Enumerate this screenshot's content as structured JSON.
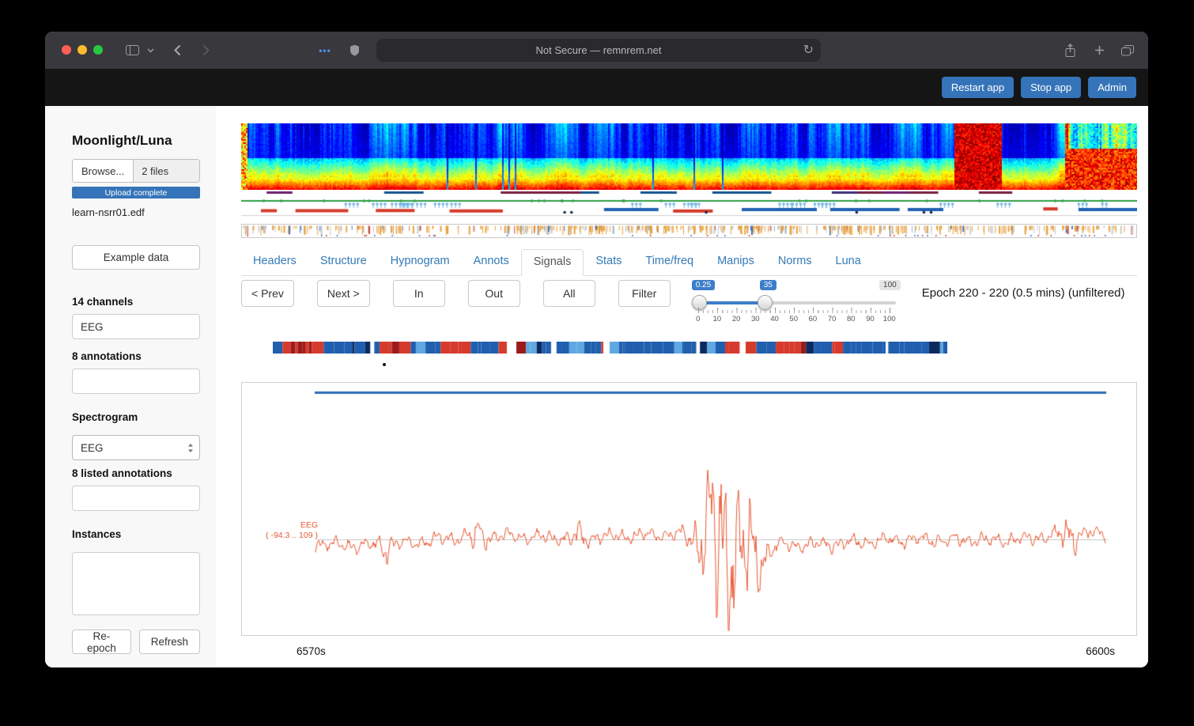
{
  "colors": {
    "accent_blue": "#3574b9",
    "link_blue": "#337ab7",
    "signal_orange": "#e85a35",
    "green_line": "#2f9e44"
  },
  "browser": {
    "address": "Not Secure — remnrem.net"
  },
  "app_header": {
    "restart_label": "Restart app",
    "stop_label": "Stop app",
    "admin_label": "Admin"
  },
  "sidebar": {
    "title": "Moonlight/Luna",
    "browse_label": "Browse...",
    "files_count": "2 files",
    "upload_status": "Upload complete",
    "filename": "learn-nsrr01.edf",
    "example_data_label": "Example data",
    "channels_heading": "14 channels",
    "channel_selected": "EEG",
    "annotations_heading": "8 annotations",
    "spectrogram_heading": "Spectrogram",
    "spectrogram_selected": "EEG",
    "listed_annotations_heading": "8 listed annotations",
    "instances_heading": "Instances",
    "reepoch_label": "Re-epoch",
    "refresh_label": "Refresh"
  },
  "tabs": [
    {
      "label": "Headers"
    },
    {
      "label": "Structure"
    },
    {
      "label": "Hypnogram"
    },
    {
      "label": "Annots"
    },
    {
      "label": "Signals"
    },
    {
      "label": "Stats"
    },
    {
      "label": "Time/freq"
    },
    {
      "label": "Manips"
    },
    {
      "label": "Norms"
    },
    {
      "label": "Luna"
    }
  ],
  "active_tab": "Signals",
  "controls": {
    "prev_label": "< Prev",
    "next_label": "Next >",
    "in_label": "In",
    "out_label": "Out",
    "all_label": "All",
    "filter_label": "Filter",
    "epoch_text": "Epoch 220 - 220 (0.5 mins) (unfiltered)"
  },
  "slider": {
    "low_value": "0.25",
    "high_value": "35",
    "max_value": "100",
    "tick_labels": [
      "0",
      "10",
      "20",
      "30",
      "40",
      "50",
      "60",
      "70",
      "80",
      "90",
      "100"
    ]
  },
  "signal_view": {
    "channel_label": "EEG",
    "range_label": "( -94.3 .. 109 )",
    "start_time": "6570s",
    "end_time": "6600s"
  }
}
